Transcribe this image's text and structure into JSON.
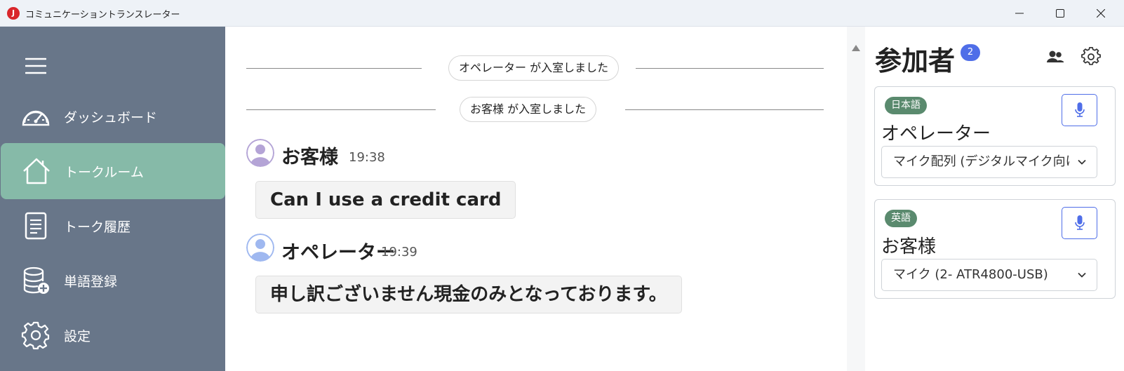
{
  "window": {
    "logo_text": "J",
    "title": "コミュニケーショントランスレーター"
  },
  "sidebar": {
    "items": [
      {
        "label": "ダッシュボード",
        "icon": "dashboard-gauge-icon"
      },
      {
        "label": "トークルーム",
        "icon": "home-icon",
        "active": true
      },
      {
        "label": "トーク履歴",
        "icon": "document-icon"
      },
      {
        "label": "単語登録",
        "icon": "database-add-icon"
      },
      {
        "label": "設定",
        "icon": "gear-icon"
      }
    ]
  },
  "chat": {
    "system_messages": [
      "オペレーター が入室しました",
      "お客様 が入室しました"
    ],
    "messages": [
      {
        "sender": "お客様",
        "time": "19:38",
        "text": "Can I use a credit card"
      },
      {
        "sender": "オペレーター",
        "time": "19:39",
        "text": "申し訳ございません現金のみとなっております。"
      }
    ]
  },
  "participants": {
    "title": "参加者",
    "count": "2",
    "cards": [
      {
        "language": "日本語",
        "name": "オペレーター",
        "mic": "マイク配列 (デジタルマイク向けインテル® スマート・サウンド・テクノロジー)"
      },
      {
        "language": "英語",
        "name": "お客様",
        "mic": "マイク (2- ATR4800-USB)"
      }
    ]
  },
  "colors": {
    "sidebar_bg": "#687689",
    "active_item": "#86baa8",
    "accent_blue": "#4f6ee8",
    "badge_green": "#5a8a6e"
  }
}
